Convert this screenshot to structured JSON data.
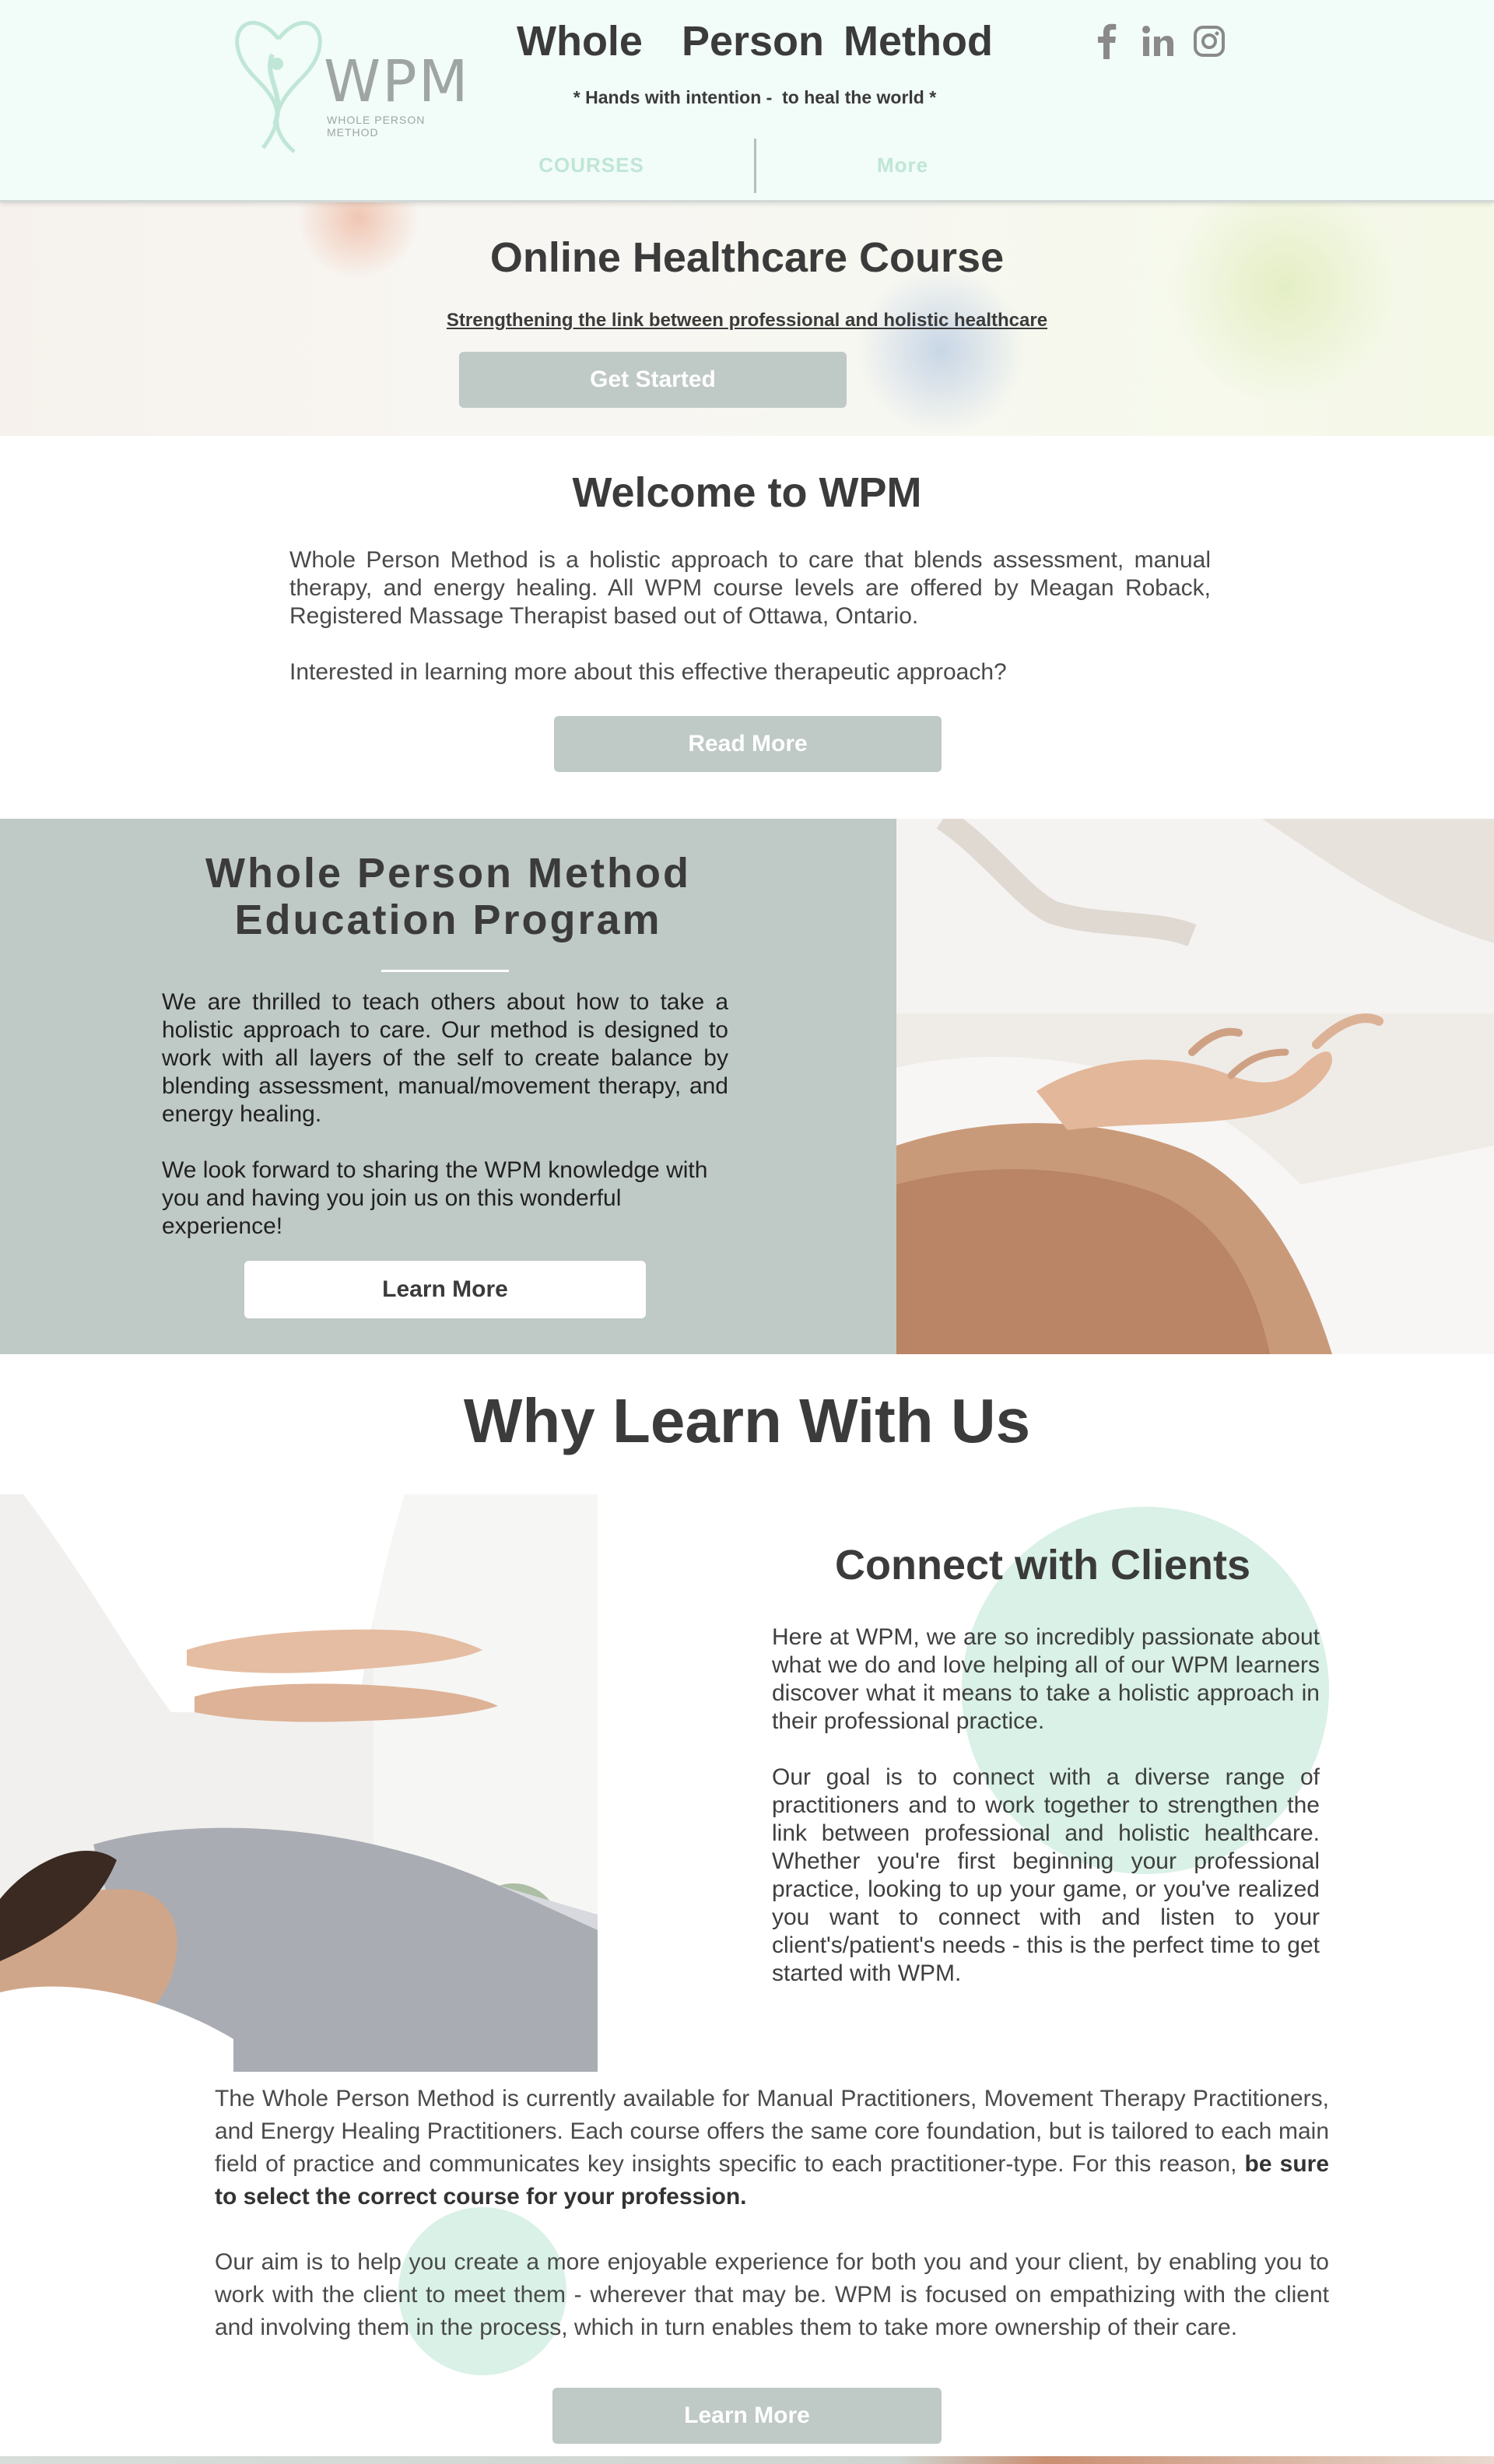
{
  "header": {
    "logo_text": "WPM",
    "logo_subtext": "WHOLE PERSON METHOD",
    "site_title": "Whole  Person Method",
    "tagline": "* Hands with intention -  to heal the world *",
    "social": [
      "facebook-icon",
      "linkedin-icon",
      "instagram-icon"
    ],
    "nav": [
      {
        "label": "COURSES"
      },
      {
        "label": "More"
      }
    ]
  },
  "hero": {
    "title": "Online Healthcare Course",
    "subtitle": "Strengthening the link between professional and holistic healthcare",
    "cta_label": "Get Started"
  },
  "welcome": {
    "title": "Welcome to WPM",
    "paragraph_1": "Whole Person Method is a holistic approach to care that blends assessment, manual therapy, and energy healing. All WPM course levels are offered by Meagan Roback, Registered Massage Therapist based out of Ottawa, Ontario.",
    "paragraph_2": "Interested in learning more about this effective therapeutic approach?",
    "cta_label": "Read More"
  },
  "education": {
    "title_line_1": "Whole Person Method",
    "title_line_2": "Education Program",
    "paragraph_1": "We are thrilled to teach others about how to take a holistic approach to care. Our method is designed to work with all layers of the self to create balance by blending assessment, manual/movement therapy, and energy healing.",
    "paragraph_2": "We look forward to sharing the WPM knowledge with you and having you join us on this wonderful experience!",
    "cta_label": "Learn More"
  },
  "why": {
    "title": "Why Learn With Us",
    "connect_title": "Connect with Clients",
    "connect_paragraph_1": "Here at WPM, we are so incredibly passionate about what we do and love helping all of our WPM learners discover what it means to take a holistic approach in their professional practice.",
    "connect_paragraph_2": "Our goal is to connect with a diverse range of practitioners and to work together to strengthen the link between professional and holistic healthcare. Whether you're first beginning your professional practice, looking to up your game, or you've realized you want to connect with and listen to your client's/patient's needs - this is the perfect time to get started with WPM.",
    "bottom_paragraph_1": "The Whole Person Method is currently available for Manual Practitioners, Movement Therapy Practitioners, and Energy Healing Practitioners. Each course offers the same core foundation, but is tailored to each main field of practice and communicates key insights specific to each practitioner-type. For this reason, ",
    "bottom_paragraph_1_bold": "be sure to select the correct course for your profession.",
    "bottom_paragraph_2": "Our aim is to help you create a more enjoyable experience for both you and your client, by enabling you to work with the client to meet them - wherever that may be. WPM is focused on empathizing with the client and involving them in the process, which in turn enables them to take more ownership of their care.",
    "cta_label": "Learn More"
  },
  "colors": {
    "header_bg": "#f2fcf8",
    "nav_text": "#bfe6d6",
    "button_grey": "#bfc9c6",
    "education_bg": "#bfc9c6",
    "accent_circle": "#d9f1e6",
    "text_dark": "#3b3b3b"
  }
}
